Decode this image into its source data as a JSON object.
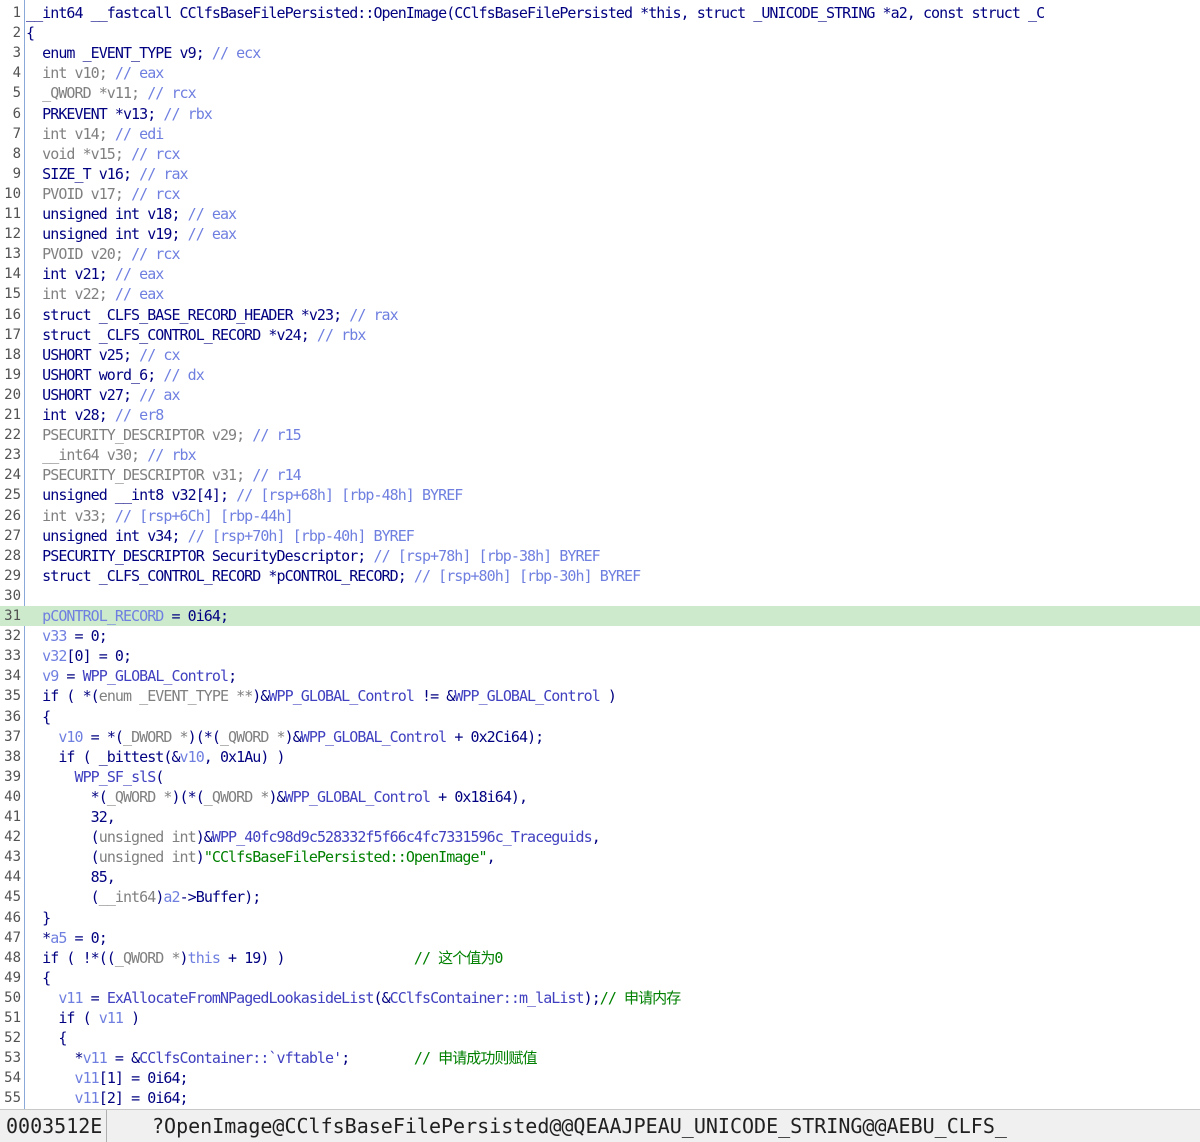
{
  "editor": {
    "highlight_line": 31,
    "lines": [
      [
        [
          "t-d",
          "__int64 __fastcall CClfsBaseFilePersisted::OpenImage(CClfsBaseFilePersisted *this, struct _UNICODE_STRING *a2, const struct _C"
        ]
      ],
      [
        [
          "t-d",
          "{"
        ]
      ],
      [
        [
          "t-d",
          "  enum _EVENT_TYPE v9; "
        ],
        [
          "t-c",
          "// ecx"
        ]
      ],
      [
        [
          "t-g",
          "  int v10; "
        ],
        [
          "t-c",
          "// eax"
        ]
      ],
      [
        [
          "t-g",
          "  _QWORD *v11; "
        ],
        [
          "t-c",
          "// rcx"
        ]
      ],
      [
        [
          "t-d",
          "  PRKEVENT *v13; "
        ],
        [
          "t-c",
          "// rbx"
        ]
      ],
      [
        [
          "t-g",
          "  int v14; "
        ],
        [
          "t-c",
          "// edi"
        ]
      ],
      [
        [
          "t-g",
          "  void *v15; "
        ],
        [
          "t-c",
          "// rcx"
        ]
      ],
      [
        [
          "t-d",
          "  SIZE_T v16; "
        ],
        [
          "t-c",
          "// rax"
        ]
      ],
      [
        [
          "t-g",
          "  PVOID v17; "
        ],
        [
          "t-c",
          "// rcx"
        ]
      ],
      [
        [
          "t-d",
          "  unsigned int v18; "
        ],
        [
          "t-c",
          "// eax"
        ]
      ],
      [
        [
          "t-d",
          "  unsigned int v19; "
        ],
        [
          "t-c",
          "// eax"
        ]
      ],
      [
        [
          "t-g",
          "  PVOID v20; "
        ],
        [
          "t-c",
          "// rcx"
        ]
      ],
      [
        [
          "t-d",
          "  int v21; "
        ],
        [
          "t-c",
          "// eax"
        ]
      ],
      [
        [
          "t-g",
          "  int v22; "
        ],
        [
          "t-c",
          "// eax"
        ]
      ],
      [
        [
          "t-d",
          "  struct _CLFS_BASE_RECORD_HEADER *v23; "
        ],
        [
          "t-c",
          "// rax"
        ]
      ],
      [
        [
          "t-d",
          "  struct _CLFS_CONTROL_RECORD *v24; "
        ],
        [
          "t-c",
          "// rbx"
        ]
      ],
      [
        [
          "t-d",
          "  USHORT v25; "
        ],
        [
          "t-c",
          "// cx"
        ]
      ],
      [
        [
          "t-d",
          "  USHORT word_6; "
        ],
        [
          "t-c",
          "// dx"
        ]
      ],
      [
        [
          "t-d",
          "  USHORT v27; "
        ],
        [
          "t-c",
          "// ax"
        ]
      ],
      [
        [
          "t-d",
          "  int v28; "
        ],
        [
          "t-c",
          "// er8"
        ]
      ],
      [
        [
          "t-g",
          "  PSECURITY_DESCRIPTOR v29; "
        ],
        [
          "t-c",
          "// r15"
        ]
      ],
      [
        [
          "t-g",
          "  __int64 v30; "
        ],
        [
          "t-c",
          "// rbx"
        ]
      ],
      [
        [
          "t-g",
          "  PSECURITY_DESCRIPTOR v31; "
        ],
        [
          "t-c",
          "// r14"
        ]
      ],
      [
        [
          "t-d",
          "  unsigned __int8 v32[4]; "
        ],
        [
          "t-c",
          "// [rsp+68h] [rbp-48h] BYREF"
        ]
      ],
      [
        [
          "t-g",
          "  int v33; "
        ],
        [
          "t-c",
          "// [rsp+6Ch] [rbp-44h]"
        ]
      ],
      [
        [
          "t-d",
          "  unsigned int v34; "
        ],
        [
          "t-c",
          "// [rsp+70h] [rbp-40h] BYREF"
        ]
      ],
      [
        [
          "t-d",
          "  PSECURITY_DESCRIPTOR SecurityDescriptor; "
        ],
        [
          "t-c",
          "// [rsp+78h] [rbp-38h] BYREF"
        ]
      ],
      [
        [
          "t-d",
          "  struct _CLFS_CONTROL_RECORD *pCONTROL_RECORD; "
        ],
        [
          "t-c",
          "// [rsp+80h] [rbp-30h] BYREF"
        ]
      ],
      [
        [
          "t-d",
          ""
        ]
      ],
      [
        [
          "t-d",
          "  "
        ],
        [
          "t-v",
          "pCONTROL_RECORD"
        ],
        [
          "t-d",
          " = 0i64;"
        ]
      ],
      [
        [
          "t-d",
          "  "
        ],
        [
          "t-v",
          "v33"
        ],
        [
          "t-d",
          " = 0;"
        ]
      ],
      [
        [
          "t-d",
          "  "
        ],
        [
          "t-v",
          "v32"
        ],
        [
          "t-d",
          "[0] = 0;"
        ]
      ],
      [
        [
          "t-d",
          "  "
        ],
        [
          "t-v",
          "v9"
        ],
        [
          "t-d",
          " = "
        ],
        [
          "t-b",
          "WPP_GLOBAL_Control"
        ],
        [
          "t-d",
          ";"
        ]
      ],
      [
        [
          "t-d",
          "  if ( *("
        ],
        [
          "t-g",
          "enum _EVENT_TYPE **"
        ],
        [
          "t-d",
          ")&"
        ],
        [
          "t-b",
          "WPP_GLOBAL_Control"
        ],
        [
          "t-d",
          " != &"
        ],
        [
          "t-b",
          "WPP_GLOBAL_Control"
        ],
        [
          "t-d",
          " )"
        ]
      ],
      [
        [
          "t-d",
          "  {"
        ]
      ],
      [
        [
          "t-d",
          "    "
        ],
        [
          "t-v",
          "v10"
        ],
        [
          "t-d",
          " = *("
        ],
        [
          "t-g",
          "_DWORD *"
        ],
        [
          "t-d",
          ")(*("
        ],
        [
          "t-g",
          "_QWORD *"
        ],
        [
          "t-d",
          ")&"
        ],
        [
          "t-b",
          "WPP_GLOBAL_Control"
        ],
        [
          "t-d",
          " + 0x2Ci64);"
        ]
      ],
      [
        [
          "t-d",
          "    if ( _bittest(&"
        ],
        [
          "t-v",
          "v10"
        ],
        [
          "t-d",
          ", 0x1Au) )"
        ]
      ],
      [
        [
          "t-d",
          "      "
        ],
        [
          "t-b",
          "WPP_SF_slS"
        ],
        [
          "t-d",
          "("
        ]
      ],
      [
        [
          "t-d",
          "        *("
        ],
        [
          "t-g",
          "_QWORD *"
        ],
        [
          "t-d",
          ")(*("
        ],
        [
          "t-g",
          "_QWORD *"
        ],
        [
          "t-d",
          ")&"
        ],
        [
          "t-b",
          "WPP_GLOBAL_Control"
        ],
        [
          "t-d",
          " + 0x18i64),"
        ]
      ],
      [
        [
          "t-d",
          "        32,"
        ]
      ],
      [
        [
          "t-d",
          "        ("
        ],
        [
          "t-g",
          "unsigned int"
        ],
        [
          "t-d",
          ")&"
        ],
        [
          "t-b",
          "WPP_40fc98d9c528332f5f66c4fc7331596c_Traceguids"
        ],
        [
          "t-d",
          ","
        ]
      ],
      [
        [
          "t-d",
          "        ("
        ],
        [
          "t-g",
          "unsigned int"
        ],
        [
          "t-d",
          ")"
        ],
        [
          "t-s",
          "\"CClfsBaseFilePersisted::OpenImage\""
        ],
        [
          "t-d",
          ","
        ]
      ],
      [
        [
          "t-d",
          "        85,"
        ]
      ],
      [
        [
          "t-d",
          "        ("
        ],
        [
          "t-g",
          "__int64"
        ],
        [
          "t-d",
          ")"
        ],
        [
          "t-v",
          "a2"
        ],
        [
          "t-d",
          "->Buffer);"
        ]
      ],
      [
        [
          "t-d",
          "  }"
        ]
      ],
      [
        [
          "t-d",
          "  *"
        ],
        [
          "t-v",
          "a5"
        ],
        [
          "t-d",
          " = 0;"
        ]
      ],
      [
        [
          "t-d",
          "  if ( !*(("
        ],
        [
          "t-g",
          "_QWORD *"
        ],
        [
          "t-d",
          ")"
        ],
        [
          "t-v",
          "this"
        ],
        [
          "t-d",
          " + 19) )                "
        ],
        [
          "t-z",
          "// 这个值为0"
        ]
      ],
      [
        [
          "t-d",
          "  {"
        ]
      ],
      [
        [
          "t-d",
          "    "
        ],
        [
          "t-v",
          "v11"
        ],
        [
          "t-d",
          " = "
        ],
        [
          "t-b",
          "ExAllocateFromNPagedLookasideList"
        ],
        [
          "t-d",
          "(&"
        ],
        [
          "t-b",
          "CClfsContainer::m_laList"
        ],
        [
          "t-d",
          ");"
        ],
        [
          "t-z",
          "// 申请内存"
        ]
      ],
      [
        [
          "t-d",
          "    if ( "
        ],
        [
          "t-v",
          "v11"
        ],
        [
          "t-d",
          " )"
        ]
      ],
      [
        [
          "t-d",
          "    {"
        ]
      ],
      [
        [
          "t-d",
          "      *"
        ],
        [
          "t-v",
          "v11"
        ],
        [
          "t-d",
          " = &"
        ],
        [
          "t-b",
          "CClfsContainer::`vftable'"
        ],
        [
          "t-d",
          ";        "
        ],
        [
          "t-z",
          "// 申请成功则赋值"
        ]
      ],
      [
        [
          "t-d",
          "      "
        ],
        [
          "t-v",
          "v11"
        ],
        [
          "t-d",
          "[1] = 0i64;"
        ]
      ],
      [
        [
          "t-d",
          "      "
        ],
        [
          "t-v",
          "v11"
        ],
        [
          "t-d",
          "[2] = 0i64;"
        ]
      ]
    ]
  },
  "statusbar": {
    "address": "0003512E",
    "symbol": "?OpenImage@CClfsBaseFilePersisted@@QEAAJPEAU_UNICODE_STRING@@AEBU_CLFS_"
  }
}
